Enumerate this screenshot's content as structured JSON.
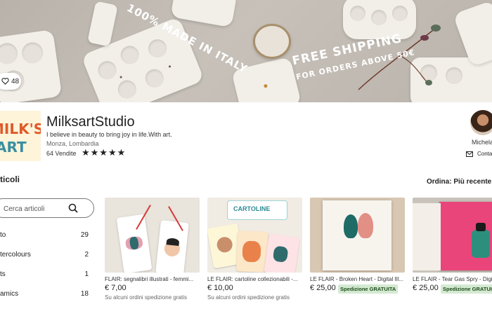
{
  "banner": {
    "made_in": "100% MADE IN ITALY",
    "free_shipping": "FREE SHIPPING",
    "orders_above": "FOR ORDERS ABOVE 50€",
    "favorites_count": "48"
  },
  "shop": {
    "logo_line1": "MILK'S",
    "logo_line2": "ART",
    "name": "MilksartStudio",
    "tagline": "I believe in beauty to bring joy in life.With art.",
    "location": "Monza, Lombardia",
    "sales": "64 Vendite",
    "rating_stars": "★★★★★",
    "rating": 5
  },
  "owner": {
    "name": "Michela",
    "contact_label": "Conta"
  },
  "section": {
    "title": "ticoli",
    "sort_label": "Ordina: Più recente"
  },
  "search": {
    "placeholder": "Cerca articoli"
  },
  "categories": [
    {
      "label": "to",
      "count": "29"
    },
    {
      "label": "tercolours",
      "count": "2"
    },
    {
      "label": "ts",
      "count": "1"
    },
    {
      "label": "amics",
      "count": "18"
    }
  ],
  "listings": [
    {
      "title": "FLAIR: segnalibri illustrati - femmi...",
      "price": "€ 7,00",
      "note": "Su alcuni ordini spedizione gratis",
      "badge": ""
    },
    {
      "title": "LE FLAIR: cartoline collezionabili -...",
      "price": "€ 10,00",
      "note": "Su alcuni ordini spedizione gratis",
      "badge": ""
    },
    {
      "title": "LE FLAIR - Broken Heart - Digital Ill...",
      "price": "€ 25,00",
      "note": "",
      "badge": "Spedizione GRATUITA"
    },
    {
      "title": "LE FLAIR - Tear Gas Spry - Digit",
      "price": "€ 25,00",
      "note": "",
      "badge": "Spedizione GRATUITA"
    }
  ],
  "cartoline_text": "CARTOLINE"
}
